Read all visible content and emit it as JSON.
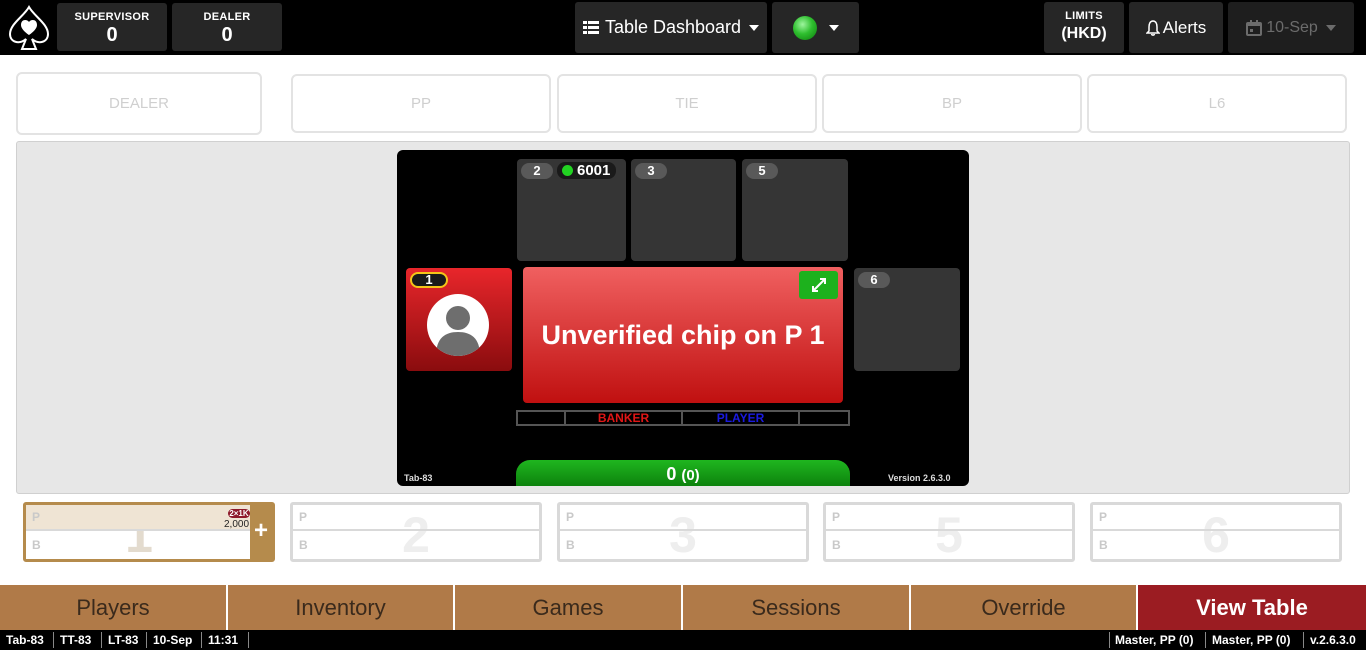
{
  "header": {
    "supervisor_label": "SUPERVISOR",
    "supervisor_value": "0",
    "dealer_label": "DEALER",
    "dealer_value": "0",
    "dashboard_label": "Table Dashboard",
    "limits_label": "LIMITS",
    "limits_currency": "(HKD)",
    "alerts_label": "Alerts",
    "date_label": "10-Sep"
  },
  "bet_zones": [
    "DEALER",
    "PP",
    "TIE",
    "BP",
    "L6"
  ],
  "table": {
    "seats_top": [
      {
        "num": "2",
        "chip": "6001"
      },
      {
        "num": "3"
      },
      {
        "num": "5"
      }
    ],
    "seat_right": {
      "num": "6"
    },
    "seat_active": {
      "num": "1"
    },
    "alert_text": "Unverified chip on P 1",
    "banker_label": "BANKER",
    "player_label": "PLAYER",
    "total": "0",
    "total_sub": "(0)",
    "tab_label": "Tab-83",
    "version_label": "Version 2.6.3.0"
  },
  "seat_cards": [
    {
      "num": "1",
      "p": "P",
      "b": "B",
      "badge": "2×1K",
      "amount": "2,000"
    },
    {
      "num": "2",
      "p": "P",
      "b": "B"
    },
    {
      "num": "3",
      "p": "P",
      "b": "B"
    },
    {
      "num": "5",
      "p": "P",
      "b": "B"
    },
    {
      "num": "6",
      "p": "P",
      "b": "B"
    }
  ],
  "nav": [
    "Players",
    "Inventory",
    "Games",
    "Sessions",
    "Override",
    "View Table"
  ],
  "status": {
    "tab": "Tab-83",
    "tt": "TT-83",
    "lt": "LT-83",
    "date": "10-Sep",
    "time": "11:31",
    "master1": "Master, PP (0)",
    "master2": "Master, PP (0)",
    "version": "v.2.6.3.0"
  }
}
